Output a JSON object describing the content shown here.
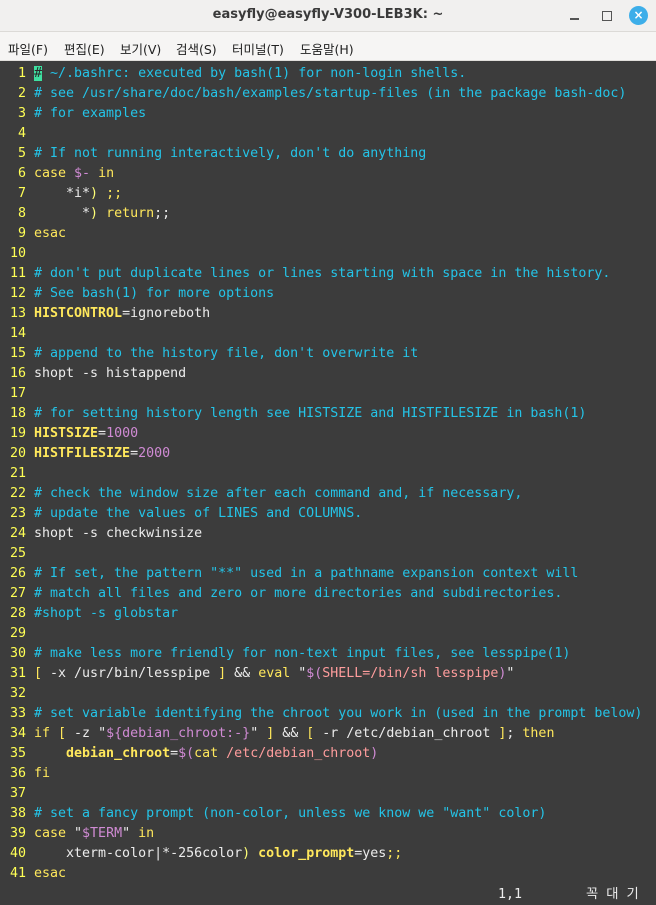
{
  "window": {
    "title": "easyfly@easyfly-V300-LEB3K: ~",
    "close_glyph": "×"
  },
  "menu": [
    "파일(F)",
    "편집(E)",
    "보기(V)",
    "검색(S)",
    "터미널(T)",
    "도움말(H)"
  ],
  "editor": {
    "lines": [
      [
        {
          "t": "#",
          "c": "cursor"
        },
        {
          "t": " ~/.bashrc: executed by bash(1) for non-login shells.",
          "c": "c"
        }
      ],
      [
        {
          "t": "# see /usr/share/doc/bash/examples/startup-files (in the package bash-doc)",
          "c": "c"
        }
      ],
      [
        {
          "t": "# for examples",
          "c": "c"
        }
      ],
      [],
      [
        {
          "t": "# If not running interactively, don't do anything",
          "c": "c"
        }
      ],
      [
        {
          "t": "case",
          "c": "k"
        },
        {
          "t": " "
        },
        {
          "t": "$-",
          "c": "v"
        },
        {
          "t": " "
        },
        {
          "t": "in",
          "c": "k"
        }
      ],
      [
        {
          "t": "    *i*"
        },
        {
          "t": ")",
          "c": "p"
        },
        {
          "t": " "
        },
        {
          "t": ";;",
          "c": "k"
        }
      ],
      [
        {
          "t": "      *"
        },
        {
          "t": ")",
          "c": "p"
        },
        {
          "t": " "
        },
        {
          "t": "return",
          "c": "k"
        },
        {
          "t": ";;"
        }
      ],
      [
        {
          "t": "esac",
          "c": "k"
        }
      ],
      [],
      [
        {
          "t": "# don't put duplicate lines or lines starting with space in the history.",
          "c": "c"
        }
      ],
      [
        {
          "t": "# See bash(1) for more options",
          "c": "c"
        }
      ],
      [
        {
          "t": "HISTCONTROL",
          "c": "b"
        },
        {
          "t": "=ignoreboth"
        }
      ],
      [],
      [
        {
          "t": "# append to the history file, don't overwrite it",
          "c": "c"
        }
      ],
      [
        {
          "t": "shopt -s histappend"
        }
      ],
      [],
      [
        {
          "t": "# for setting history length see HISTSIZE and HISTFILESIZE in bash(1)",
          "c": "c"
        }
      ],
      [
        {
          "t": "HISTSIZE",
          "c": "b"
        },
        {
          "t": "="
        },
        {
          "t": "1000",
          "c": "v"
        }
      ],
      [
        {
          "t": "HISTFILESIZE",
          "c": "b"
        },
        {
          "t": "="
        },
        {
          "t": "2000",
          "c": "v"
        }
      ],
      [],
      [
        {
          "t": "# check the window size after each command and, if necessary,",
          "c": "c"
        }
      ],
      [
        {
          "t": "# update the values of LINES and COLUMNS.",
          "c": "c"
        }
      ],
      [
        {
          "t": "shopt -s checkwinsize"
        }
      ],
      [],
      [
        {
          "t": "# If set, the pattern \"**\" used in a pathname expansion context will",
          "c": "c"
        }
      ],
      [
        {
          "t": "# match all files and zero or more directories and subdirectories.",
          "c": "c"
        }
      ],
      [
        {
          "t": "#shopt -s globstar",
          "c": "c"
        }
      ],
      [],
      [
        {
          "t": "# make less more friendly for non-text input files, see lesspipe(1)",
          "c": "c"
        }
      ],
      [
        {
          "t": "[",
          "c": "k"
        },
        {
          "t": " -x /usr/bin/lesspipe "
        },
        {
          "t": "]",
          "c": "k"
        },
        {
          "t": " && "
        },
        {
          "t": "eval",
          "c": "k"
        },
        {
          "t": " \""
        },
        {
          "t": "$(",
          "c": "v"
        },
        {
          "t": "SHELL",
          "c": "s"
        },
        {
          "t": "=/bin/sh lesspipe",
          "c": "s"
        },
        {
          "t": ")",
          "c": "v"
        },
        {
          "t": "\""
        }
      ],
      [],
      [
        {
          "t": "# set variable identifying the chroot you work in (used in the prompt below)",
          "c": "c"
        }
      ],
      [
        {
          "t": "if",
          "c": "k"
        },
        {
          "t": " "
        },
        {
          "t": "[",
          "c": "k"
        },
        {
          "t": " -z \""
        },
        {
          "t": "${debian_chroot:-}",
          "c": "v"
        },
        {
          "t": "\" "
        },
        {
          "t": "]",
          "c": "k"
        },
        {
          "t": " && "
        },
        {
          "t": "[",
          "c": "k"
        },
        {
          "t": " -r /etc/debian_chroot "
        },
        {
          "t": "]",
          "c": "k"
        },
        {
          "t": "; "
        },
        {
          "t": "then",
          "c": "k"
        }
      ],
      [
        {
          "t": "    "
        },
        {
          "t": "debian_chroot",
          "c": "b"
        },
        {
          "t": "="
        },
        {
          "t": "$(",
          "c": "v"
        },
        {
          "t": "cat",
          "c": "k"
        },
        {
          "t": " /etc/debian_chroot",
          "c": "s"
        },
        {
          "t": ")",
          "c": "v"
        }
      ],
      [
        {
          "t": "fi",
          "c": "k"
        }
      ],
      [],
      [
        {
          "t": "# set a fancy prompt (non-color, unless we know we \"want\" color)",
          "c": "c"
        }
      ],
      [
        {
          "t": "case",
          "c": "k"
        },
        {
          "t": " \""
        },
        {
          "t": "$TERM",
          "c": "v"
        },
        {
          "t": "\" "
        },
        {
          "t": "in",
          "c": "k"
        }
      ],
      [
        {
          "t": "    xterm-color|*-256color"
        },
        {
          "t": ")",
          "c": "p"
        },
        {
          "t": " "
        },
        {
          "t": "color_prompt",
          "c": "b"
        },
        {
          "t": "=yes"
        },
        {
          "t": ";;",
          "c": "k"
        }
      ],
      [
        {
          "t": "esac",
          "c": "k"
        }
      ]
    ],
    "status": {
      "position": "1,1",
      "mode": "꼭 대 기"
    }
  }
}
